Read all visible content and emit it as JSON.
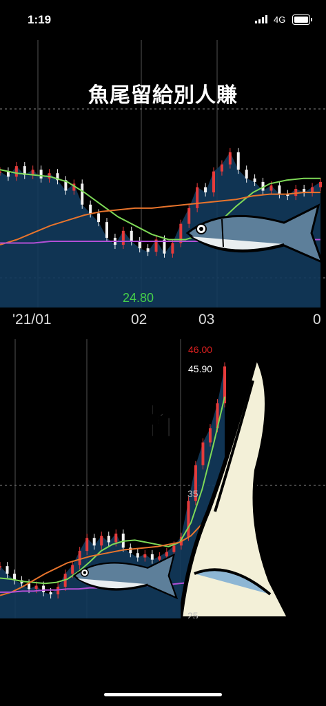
{
  "status_bar": {
    "time": "1:19",
    "network": "4G"
  },
  "chart_data": [
    {
      "type": "candlestick",
      "title": "魚尾留給別人賺",
      "x_ticks": [
        "'21/01",
        "02",
        "03",
        "0"
      ],
      "annotations": [
        {
          "text": "24.80",
          "color": "#46d04a"
        }
      ],
      "series": [
        {
          "values": [
            29.5,
            29.2,
            29.8,
            29.3,
            29.6,
            29.1,
            29.4,
            29.0,
            28.4,
            28.8,
            27.6,
            27.1,
            26.6,
            25.7,
            25.3,
            26.1,
            25.5,
            25.1,
            24.9,
            25.6,
            24.8,
            25.4,
            26.5,
            27.4,
            28.6,
            28.3,
            29.5,
            29.9,
            30.6,
            29.6,
            29.1,
            28.9,
            28.4,
            28.7,
            28.2,
            28.1,
            28.5,
            28.3,
            28.6,
            28.9
          ]
        },
        {
          "values": [
            29.6,
            29.4,
            29.3,
            29.2,
            28.9,
            28.3,
            27.6,
            26.9,
            26.4,
            25.9,
            25.6,
            25.6,
            25.9,
            26.6,
            27.5,
            28.3,
            28.8,
            29.0,
            29.1,
            29.1
          ]
        },
        {
          "values": [
            25.3,
            25.6,
            26.0,
            26.4,
            26.7,
            27.0,
            27.2,
            27.3,
            27.4,
            27.4,
            27.5,
            27.6,
            27.7,
            27.8,
            27.9,
            28.1,
            28.2,
            28.2,
            28.3,
            28.3
          ]
        },
        {
          "values": [
            25.4,
            25.4,
            25.4,
            25.5,
            25.5,
            25.5,
            25.5,
            25.5,
            25.5,
            25.5,
            25.5,
            25.5,
            25.5,
            25.5,
            25.5,
            25.6,
            25.6,
            25.6,
            25.6,
            25.6
          ]
        }
      ]
    },
    {
      "type": "candlestick",
      "caption": "幹",
      "y_ticks": [
        "35",
        "25"
      ],
      "annotations": [
        {
          "text": "46.00",
          "color": "#e02020"
        },
        {
          "text": "45.90",
          "color": "#ffffff"
        }
      ],
      "series": [
        {
          "values": [
            27.5,
            26.8,
            26.2,
            25.9,
            25.4,
            25.7,
            25.1,
            24.9,
            25.6,
            26.8,
            27.6,
            28.9,
            30.1,
            29.4,
            30.3,
            29.7,
            30.5,
            29.2,
            28.7,
            28.3,
            28.6,
            28.1,
            28.4,
            28.8,
            29.4,
            30.2,
            33.5,
            36.8,
            38.9,
            40.2,
            42.5,
            45.9
          ]
        },
        {
          "values": [
            26.4,
            26.3,
            26.1,
            26.0,
            25.9,
            26.0,
            26.3,
            27.0,
            27.9,
            28.9,
            29.5,
            29.8,
            29.9,
            29.7,
            29.5,
            29.3,
            29.7,
            31.5,
            34.6,
            38.7,
            43.1
          ]
        },
        {
          "values": [
            24.8,
            25.1,
            25.6,
            26.2,
            26.8,
            27.3,
            27.8,
            28.1,
            28.4,
            28.6,
            28.8,
            29.0,
            29.1,
            29.2,
            29.3,
            29.5,
            29.7,
            30.3,
            31.4,
            33.6,
            36.1
          ]
        },
        {
          "values": [
            25.1,
            25.1,
            25.2,
            25.2,
            25.3,
            25.3,
            25.4,
            25.4,
            25.5,
            25.5,
            25.6,
            25.6,
            25.7,
            25.7,
            25.8,
            25.8,
            25.9,
            26.0,
            26.3,
            26.8,
            27.4
          ]
        }
      ]
    }
  ],
  "colors": {
    "up": "#e53b3b",
    "down": "#f2f2f2",
    "ma_green": "#7ed957",
    "ma_orange": "#e8742c",
    "ma_purple": "#b24fd6",
    "ma_violet": "#7a5cff",
    "accent_green": "#46d04a"
  }
}
